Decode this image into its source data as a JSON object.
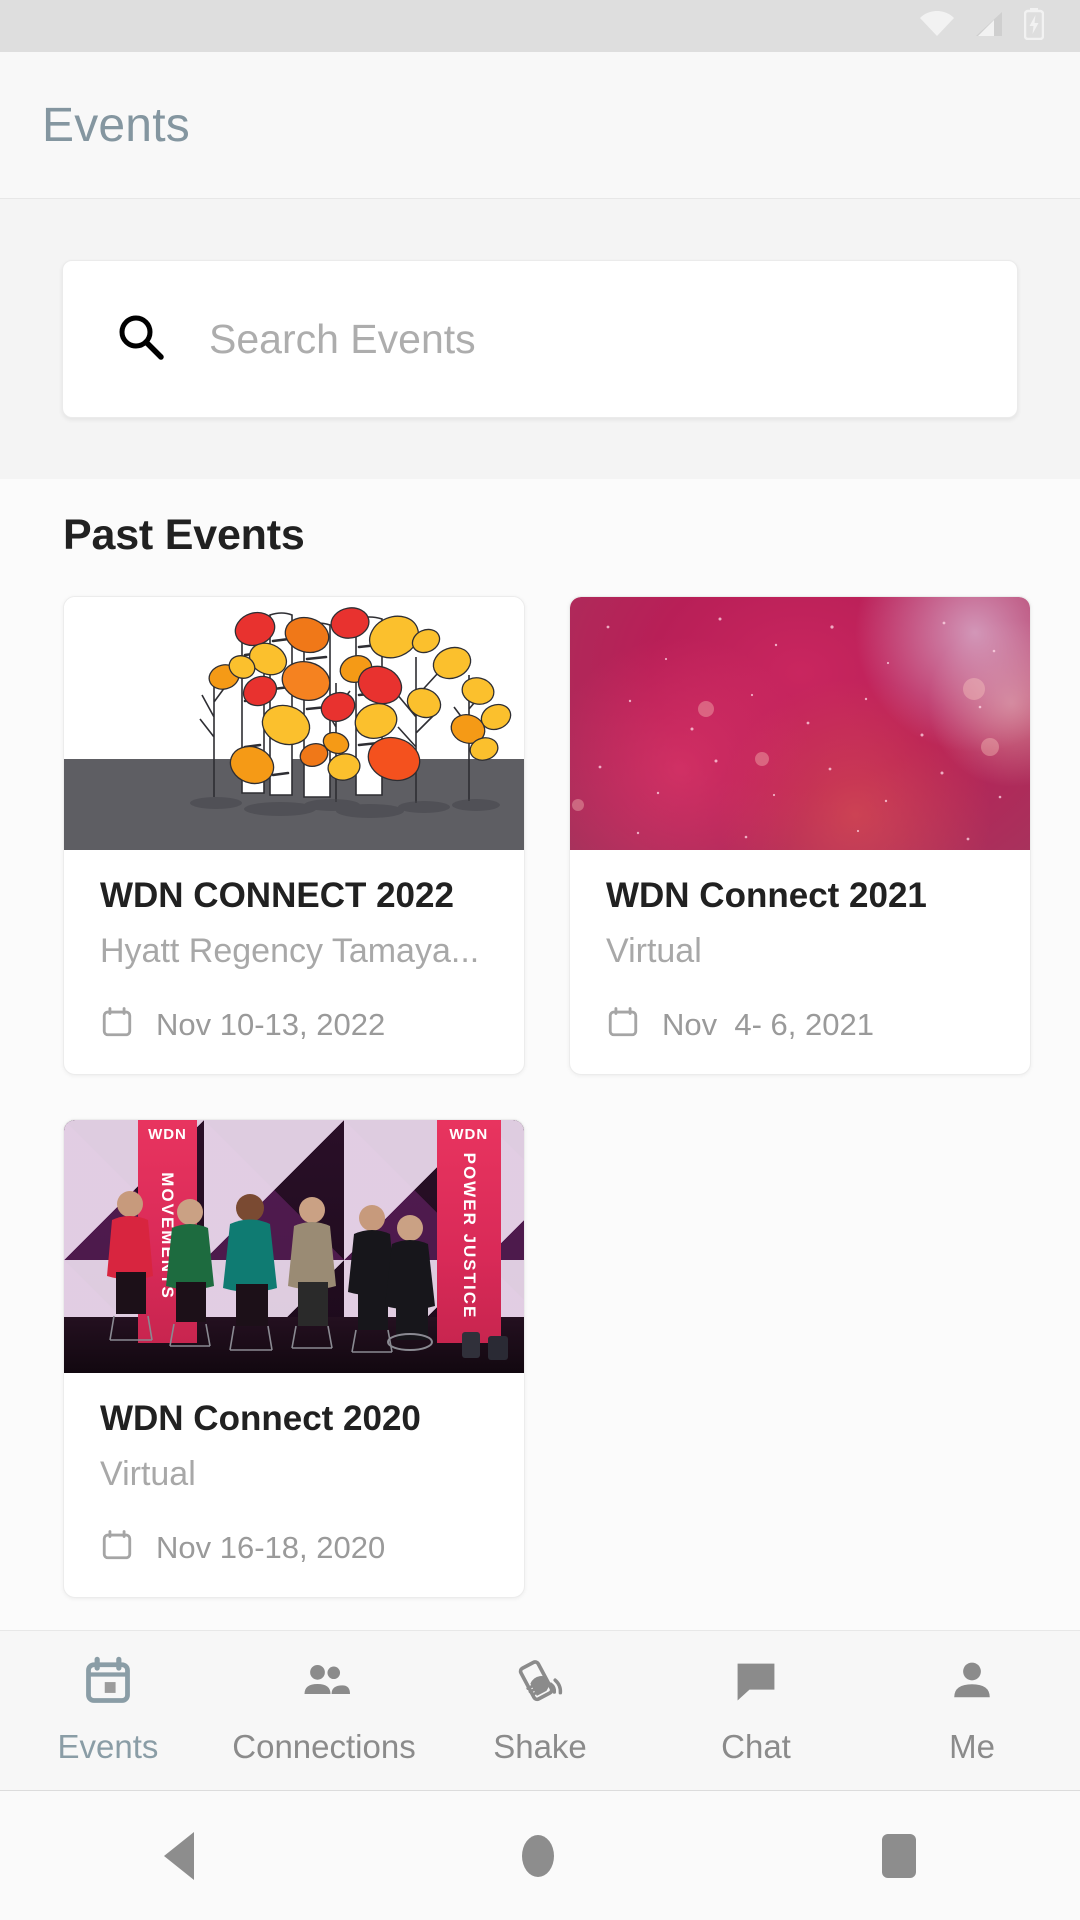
{
  "statusbar": {
    "wifi_icon": "wifi-icon",
    "signal_icon": "cell-signal-icon",
    "battery_icon": "battery-charging-icon"
  },
  "appbar": {
    "title": "Events"
  },
  "search": {
    "icon": "search-icon",
    "placeholder": "Search Events",
    "value": ""
  },
  "main": {
    "section_title": "Past Events",
    "events": [
      {
        "title": "WDN CONNECT 2022",
        "location": "Hyatt Regency Tamaya...",
        "date": "Nov 10-13, 2022",
        "date_icon": "calendar-icon",
        "thumb": "autumn-trees-illustration"
      },
      {
        "title": "WDN Connect 2021",
        "location": "Virtual",
        "date": "Nov  4- 6, 2021",
        "date_icon": "calendar-icon",
        "thumb": "pink-nebula-image"
      },
      {
        "title": "WDN Connect 2020",
        "location": "Virtual",
        "date": "Nov 16-18, 2020",
        "date_icon": "calendar-icon",
        "thumb": "panel-stage-photo"
      }
    ]
  },
  "panel_photo": {
    "banner_left_text": "MOVEMENTS",
    "banner_right_text": "POWER JUSTICE",
    "banner_logo": "WDN"
  },
  "bottom_nav": {
    "items": [
      {
        "label": "Events",
        "icon": "calendar-icon",
        "active": true
      },
      {
        "label": "Connections",
        "icon": "people-icon",
        "active": false
      },
      {
        "label": "Shake",
        "icon": "shake-phone-icon",
        "active": false
      },
      {
        "label": "Chat",
        "icon": "chat-bubble-icon",
        "active": false
      },
      {
        "label": "Me",
        "icon": "person-icon",
        "active": false
      }
    ]
  },
  "system_nav": {
    "back": "back-button",
    "home": "home-button",
    "recents": "recents-button"
  },
  "colors": {
    "accent": "#8a9da6",
    "title_text": "#212121",
    "muted_text": "#a8a8a8",
    "appbar_bg": "#f8f8f8",
    "search_section_bg": "#f4f4f4",
    "brand_pink": "#d92a58"
  }
}
